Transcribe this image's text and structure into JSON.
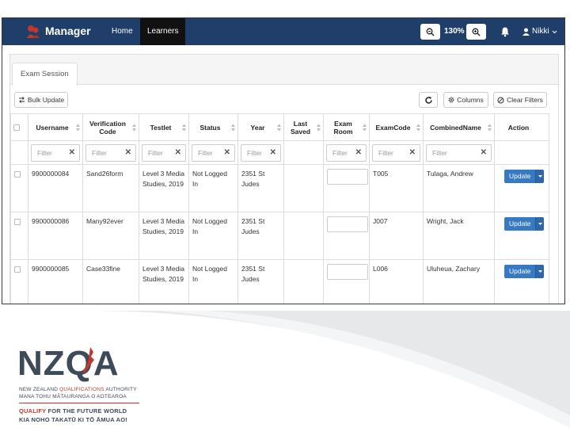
{
  "navbar": {
    "brand": "Manager",
    "links": [
      "Home",
      "Learners"
    ],
    "zoom": "130%",
    "user": "Nikki"
  },
  "tab": "Exam Session",
  "toolbar": {
    "bulk_update": "Bulk Update",
    "columns": "Columns",
    "clear_filters": "Clear Filters"
  },
  "table": {
    "headers": {
      "username": "Username",
      "verification_code": "Verification Code",
      "testlet": "Testlet",
      "status": "Status",
      "year": "Year",
      "last_saved": "Last Saved",
      "exam_room": "Exam Room",
      "exam_code": "ExamCode",
      "combined_name": "CombinedName",
      "action": "Action"
    },
    "filter_placeholder": "Filter",
    "filter_clear": "✕",
    "rows": [
      {
        "username": "9900000084",
        "verification_code": "Sand26form",
        "testlet": "Level 3 Media Studies, 2019",
        "status": "Not Logged In",
        "year": "2351 St Judes",
        "last_saved": "",
        "exam_code": "T005",
        "combined_name": "Tulaga, Andrew",
        "action": "Update"
      },
      {
        "username": "9900000086",
        "verification_code": "Many92ever",
        "testlet": "Level 3 Media Studies, 2019",
        "status": "Not Logged In",
        "year": "2351 St Judes",
        "last_saved": "",
        "exam_code": "J007",
        "combined_name": "Wright, Jack",
        "action": "Update"
      },
      {
        "username": "9900000085",
        "verification_code": "Case33fine",
        "testlet": "Level 3 Media Studies, 2019",
        "status": "Not Logged In",
        "year": "2351 St Judes",
        "last_saved": "",
        "exam_code": "L006",
        "combined_name": "Uluheua, Zachary",
        "action": "Update"
      }
    ]
  },
  "footer": {
    "logo_word": "NZQA",
    "line1_a": "NEW ZEALAND ",
    "line1_b": "QUALIFICATIONS",
    "line1_c": " AUTHORITY",
    "line2": "MANA TOHU MĀTAURANGA O AOTEAROA",
    "line3_a": "QUALIFY",
    "line3_b": " FOR THE FUTURE WORLD",
    "line4": "KIA NOHO TAKATŪ KI TŌ ĀMUA AO!"
  },
  "colors": {
    "navbar": "#1f3f6a",
    "update_button": "#3879c3",
    "brand_red": "#c0392b"
  }
}
